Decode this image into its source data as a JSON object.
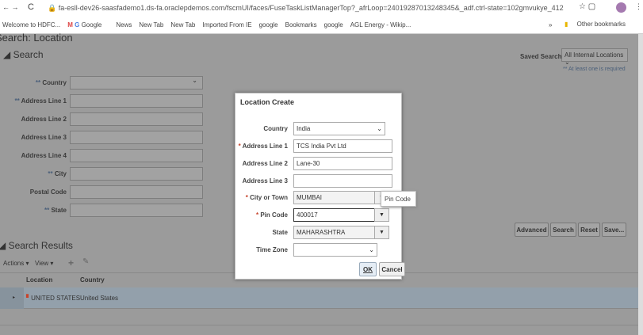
{
  "browser": {
    "url": "fa-esll-dev26-saasfademo1.ds-fa.oraclepdemos.com/fscmUI/faces/FuseTaskListManagerTop?_afrLoop=24019287013248345&_adf.ctrl-state=102gmvukye_412",
    "bookmarks": [
      "Welcome to HDFC...",
      "Google",
      "News",
      "New Tab",
      "New Tab",
      "Imported From IE",
      "google",
      "Bookmarks",
      "google",
      "AGL Energy - Wikip..."
    ],
    "other_bookmarks": "Other bookmarks",
    "more": "»"
  },
  "page": {
    "title": "Search: Location",
    "search_header": "Search",
    "saved_search_label": "Saved Search",
    "saved_search_value": "All Internal Locations",
    "required_note": "** At least one is required",
    "fields": [
      {
        "label": "Country",
        "req": "**"
      },
      {
        "label": "Address Line 1",
        "req": "**"
      },
      {
        "label": "Address Line 2",
        "req": ""
      },
      {
        "label": "Address Line 3",
        "req": ""
      },
      {
        "label": "Address Line 4",
        "req": ""
      },
      {
        "label": "City",
        "req": "**"
      },
      {
        "label": "Postal Code",
        "req": ""
      },
      {
        "label": "State",
        "req": "**"
      }
    ],
    "buttons": {
      "advanced": "Advanced",
      "search": "Search",
      "reset": "Reset",
      "save": "Save..."
    },
    "results_header": "Search Results",
    "actions": "Actions",
    "view": "View",
    "columns": [
      "Location",
      "Country"
    ],
    "rows": [
      {
        "location": "UNITED STATES",
        "country": "United States"
      }
    ]
  },
  "dialog": {
    "title": "Location Create",
    "fields": [
      {
        "label": "Country",
        "req": "",
        "value": "India",
        "type": "select"
      },
      {
        "label": "Address Line 1",
        "req": "*",
        "value": "TCS India Pvt Ltd",
        "type": "text"
      },
      {
        "label": "Address Line 2",
        "req": "",
        "value": "Lane-30",
        "type": "text"
      },
      {
        "label": "Address Line 3",
        "req": "",
        "value": "",
        "type": "text"
      },
      {
        "label": "City or Town",
        "req": "*",
        "value": "MUMBAI",
        "type": "lov"
      },
      {
        "label": "Pin Code",
        "req": "*",
        "value": "400017",
        "type": "lov"
      },
      {
        "label": "State",
        "req": "",
        "value": "MAHARASHTRA",
        "type": "lov"
      },
      {
        "label": "Time Zone",
        "req": "",
        "value": "",
        "type": "select"
      }
    ],
    "tooltip": "Pin Code",
    "ok": "OK",
    "cancel": "Cancel"
  }
}
